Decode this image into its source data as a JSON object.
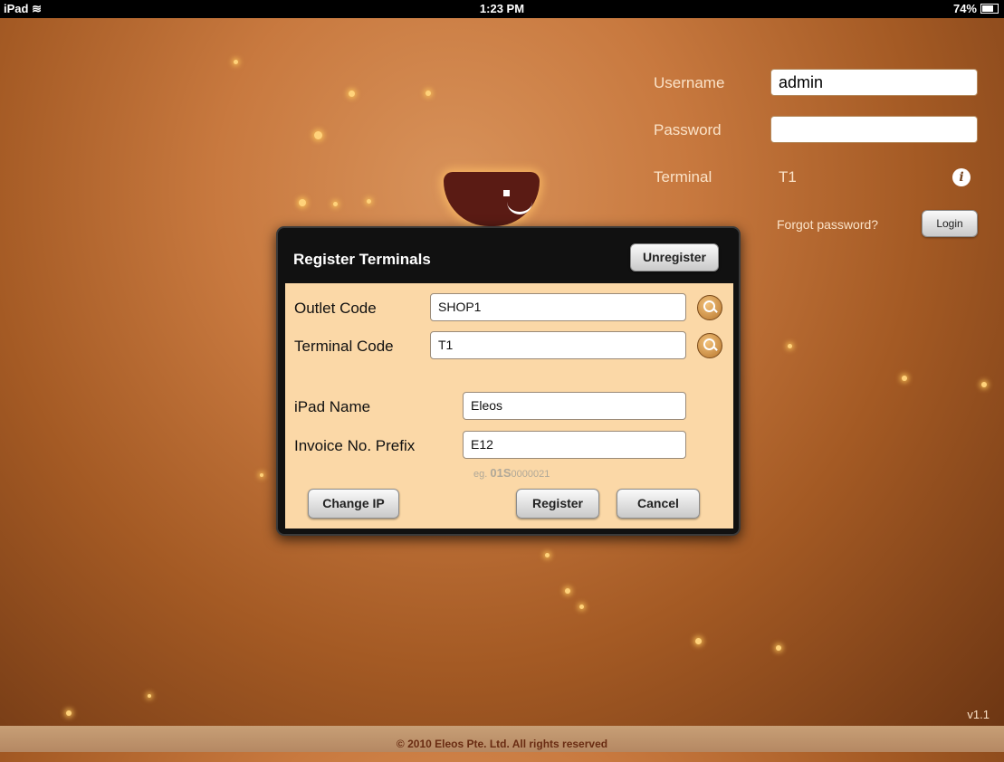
{
  "statusbar": {
    "device": "iPad",
    "time": "1:23 PM",
    "battery": "74%"
  },
  "login": {
    "username_label": "Username",
    "username_value": "admin",
    "password_label": "Password",
    "password_value": "",
    "terminal_label": "Terminal",
    "terminal_value": "T1",
    "forgot_label": "Forgot password?",
    "login_button": "Login"
  },
  "dialog": {
    "title": "Register Terminals",
    "unregister_button": "Unregister",
    "outlet_code_label": "Outlet Code",
    "outlet_code_value": "SHOP1",
    "terminal_code_label": "Terminal Code",
    "terminal_code_value": "T1",
    "ipad_name_label": "iPad Name",
    "ipad_name_value": "Eleos",
    "invoice_prefix_label": "Invoice No. Prefix",
    "invoice_prefix_value": "E12",
    "hint_prefix": "eg.",
    "hint_bold": "01S",
    "hint_rest": "0000021",
    "change_ip_button": "Change IP",
    "register_button": "Register",
    "cancel_button": "Cancel"
  },
  "version": "v1.1",
  "footer": "© 2010 Eleos Pte. Ltd. All rights reserved",
  "icons": [
    "wifi-icon",
    "battery-icon",
    "info-icon",
    "search-icon"
  ]
}
